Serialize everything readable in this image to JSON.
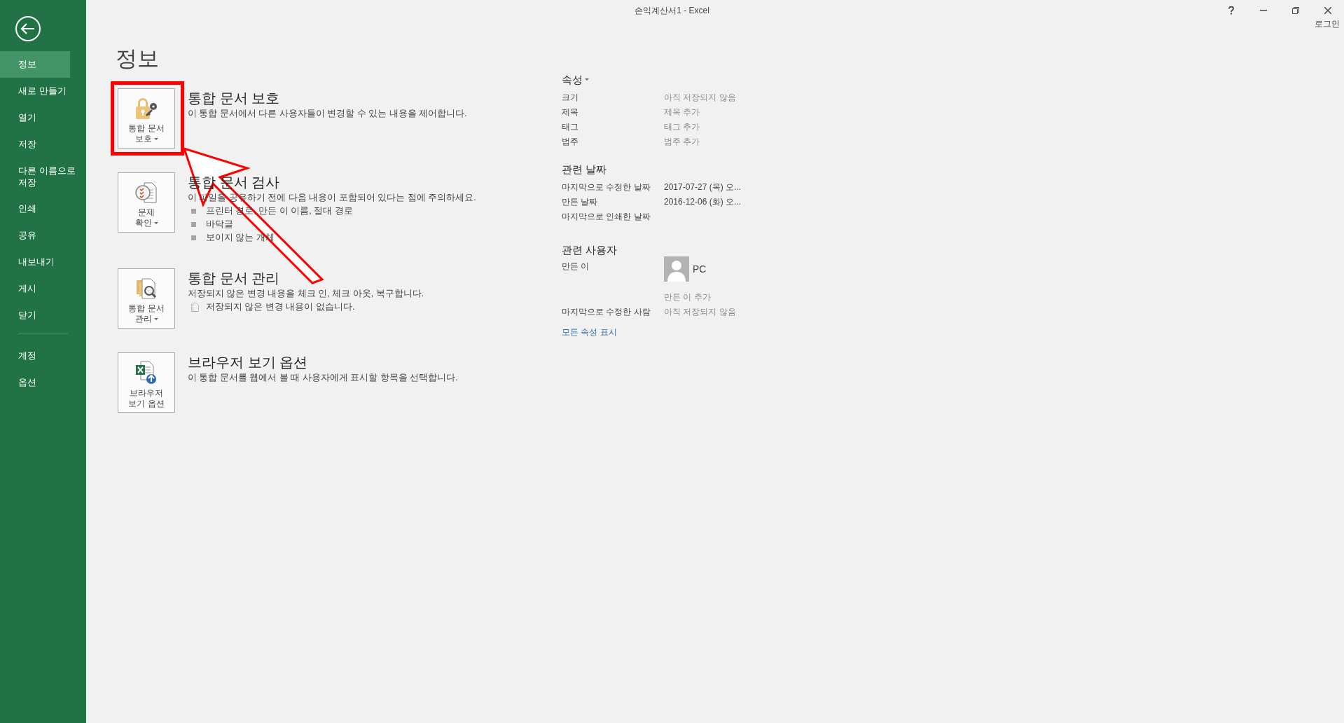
{
  "window": {
    "title": "손익계산서1 - Excel",
    "account": "로그인"
  },
  "sidebar": {
    "groups": [
      [
        {
          "label": "정보",
          "selected": true
        },
        {
          "label": "새로 만들기",
          "selected": false
        },
        {
          "label": "열기",
          "selected": false
        },
        {
          "label": "저장",
          "selected": false
        },
        {
          "label": "다른 이름으로 저장",
          "selected": false
        },
        {
          "label": "인쇄",
          "selected": false
        },
        {
          "label": "공유",
          "selected": false
        },
        {
          "label": "내보내기",
          "selected": false
        },
        {
          "label": "게시",
          "selected": false
        },
        {
          "label": "닫기",
          "selected": false
        }
      ],
      [
        {
          "label": "계정",
          "selected": false
        },
        {
          "label": "옵션",
          "selected": false
        }
      ]
    ]
  },
  "page_title": "정보",
  "sections": [
    {
      "kind": "protect",
      "button_lines": [
        "통합 문서",
        "보호"
      ],
      "has_menu": true,
      "highlighted": true,
      "title": "통합 문서 보호",
      "description": "이 통합 문서에서 다른 사용자들이 변경할 수 있는 내용을 제어합니다."
    },
    {
      "kind": "inspect",
      "button_lines": [
        "문제",
        "확인"
      ],
      "has_menu": true,
      "highlighted": false,
      "title": "통합 문서 검사",
      "description": "이 파일을 공유하기 전에 다음 내용이 포함되어 있다는 점에 주의하세요.",
      "items": [
        {
          "kind": "bullet",
          "text": "프린터 경로, 만든 이 이름, 절대 경로"
        },
        {
          "kind": "bullet",
          "text": "바닥글"
        },
        {
          "kind": "bullet",
          "text": "보이지 않는 개체"
        }
      ]
    },
    {
      "kind": "manage",
      "button_lines": [
        "통합 문서",
        "관리"
      ],
      "has_menu": true,
      "highlighted": false,
      "title": "통합 문서 관리",
      "description": "저장되지 않은 변경 내용을 체크 인, 체크 아웃, 복구합니다.",
      "items": [
        {
          "kind": "document",
          "text": "저장되지 않은 변경 내용이 없습니다."
        }
      ]
    },
    {
      "kind": "browser",
      "button_lines": [
        "브라우저",
        "보기 옵션"
      ],
      "has_menu": false,
      "highlighted": false,
      "title": "브라우저 보기 옵션",
      "description": "이 통합 문서를 웹에서 볼 때 사용자에게 표시할 항목을 선택합니다."
    }
  ],
  "annotations": [
    {
      "kind": "arrow"
    }
  ],
  "properties": {
    "heading": "속성",
    "rows": [
      {
        "label": "크기",
        "value": "아직 저장되지 않음",
        "kind": "placeholder"
      },
      {
        "label": "제목",
        "value": "제목 추가",
        "kind": "placeholder"
      },
      {
        "label": "태그",
        "value": "태그 추가",
        "kind": "placeholder"
      },
      {
        "label": "범주",
        "value": "범주 추가",
        "kind": "placeholder"
      }
    ]
  },
  "dates": {
    "heading": "관련 날짜",
    "rows": [
      {
        "label": "마지막으로 수정한 날짜",
        "value": "2017-07-27 (목) 오..."
      },
      {
        "label": "만든 날짜",
        "value": "2016-12-06 (화) 오..."
      },
      {
        "label": "마지막으로 인쇄한 날짜"
      }
    ]
  },
  "people": {
    "heading": "관련 사용자",
    "author_label": "만든 이",
    "author_name": "PC",
    "add_author": "만든 이 추가",
    "rows": [
      {
        "label": "마지막으로 수정한 사람",
        "value": "아직 저장되지 않음",
        "kind": "placeholder"
      }
    ]
  },
  "show_all_link": "모든 속성 표시"
}
